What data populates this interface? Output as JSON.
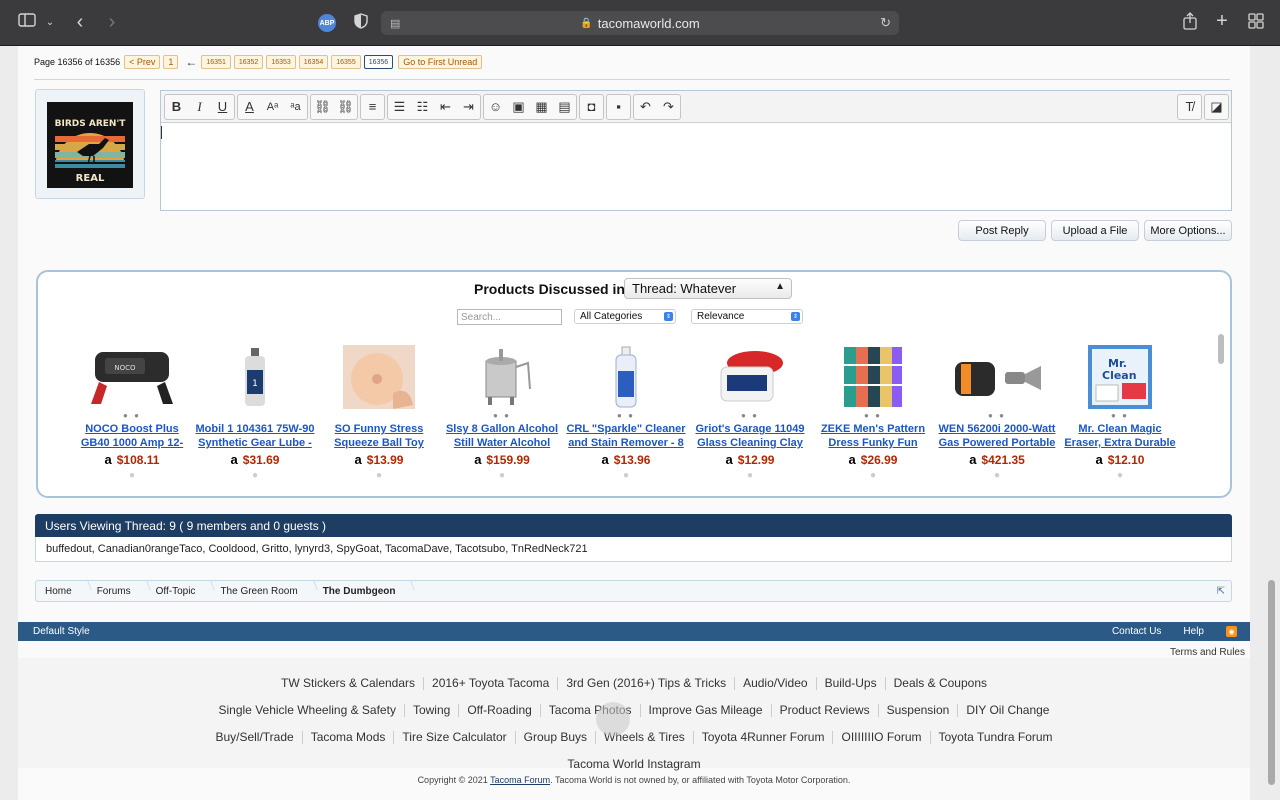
{
  "browser": {
    "url": "tacomaworld.com",
    "abp": "ABP"
  },
  "pagenav": {
    "label": "Page 16356 of 16356",
    "prev": "< Prev",
    "first": "1",
    "pages": [
      "16351",
      "16352",
      "16353",
      "16354",
      "16355",
      "16356"
    ],
    "current": "16356",
    "unread": "Go to First Unread"
  },
  "avatar": {
    "text_line1": "BIRDS AREN'T",
    "text_line2": "REAL"
  },
  "actions": {
    "post_reply": "Post Reply",
    "upload": "Upload a File",
    "more": "More Options..."
  },
  "products": {
    "title": "Products Discussed in",
    "thread_select": "Thread: Whatever",
    "search_placeholder": "Search...",
    "category": "All Categories",
    "sort": "Relevance",
    "items": [
      {
        "name1": "NOCO Boost Plus",
        "name2": "GB40 1000 Amp 12-",
        "price": "$108.11"
      },
      {
        "name1": "Mobil 1 104361 75W-90",
        "name2": "Synthetic Gear Lube -",
        "price": "$31.69"
      },
      {
        "name1": "SO Funny Stress",
        "name2": "Squeeze Ball Toy",
        "price": "$13.99"
      },
      {
        "name1": "Slsy 8 Gallon Alcohol",
        "name2": "Still Water Alcohol",
        "price": "$159.99"
      },
      {
        "name1": "CRL \"Sparkle\" Cleaner",
        "name2": "and Stain Remover - 8",
        "price": "$13.96"
      },
      {
        "name1": "Griot's Garage 11049",
        "name2": "Glass Cleaning Clay",
        "price": "$12.99"
      },
      {
        "name1": "ZEKE Men's Pattern",
        "name2": "Dress Funky Fun",
        "price": "$26.99"
      },
      {
        "name1": "WEN 56200i 2000-Watt",
        "name2": "Gas Powered Portable",
        "price": "$421.35"
      },
      {
        "name1": "Mr. Clean Magic",
        "name2": "Eraser, Extra Durable",
        "price": "$12.10"
      }
    ]
  },
  "viewers": {
    "heading": "Users Viewing Thread: 9 ( 9 members and 0 guests )",
    "list": "buffedout, Canadian0rangeTaco, Cooldood, Gritto, lynyrd3, SpyGoat, TacomaDave, Tacotsubo, TnRedNeck721"
  },
  "breadcrumb": [
    "Home",
    "Forums",
    "Off-Topic",
    "The Green Room",
    "The Dumbgeon"
  ],
  "footer": {
    "style": "Default Style",
    "contact": "Contact Us",
    "help": "Help",
    "terms": "Terms and Rules",
    "rows": [
      [
        "TW Stickers & Calendars",
        "2016+ Toyota Tacoma",
        "3rd Gen (2016+) Tips & Tricks",
        "Audio/Video",
        "Build-Ups",
        "Deals & Coupons"
      ],
      [
        "Single Vehicle Wheeling & Safety",
        "Towing",
        "Off-Roading",
        "Tacoma Photos",
        "Improve Gas Mileage",
        "Product Reviews",
        "Suspension",
        "DIY Oil Change"
      ],
      [
        "Buy/Sell/Trade",
        "Tacoma Mods",
        "Tire Size Calculator",
        "Group Buys",
        "Wheels & Tires",
        "Toyota 4Runner Forum",
        "OIIIIIIIO Forum",
        "Toyota Tundra Forum"
      ],
      [
        "Tacoma World Instagram"
      ]
    ],
    "copy_pre": "Copyright © 2021 ",
    "copy_link": "Tacoma Forum",
    "copy_post": ". Tacoma World is not owned by, or affiliated with Toyota Motor Corporation."
  }
}
